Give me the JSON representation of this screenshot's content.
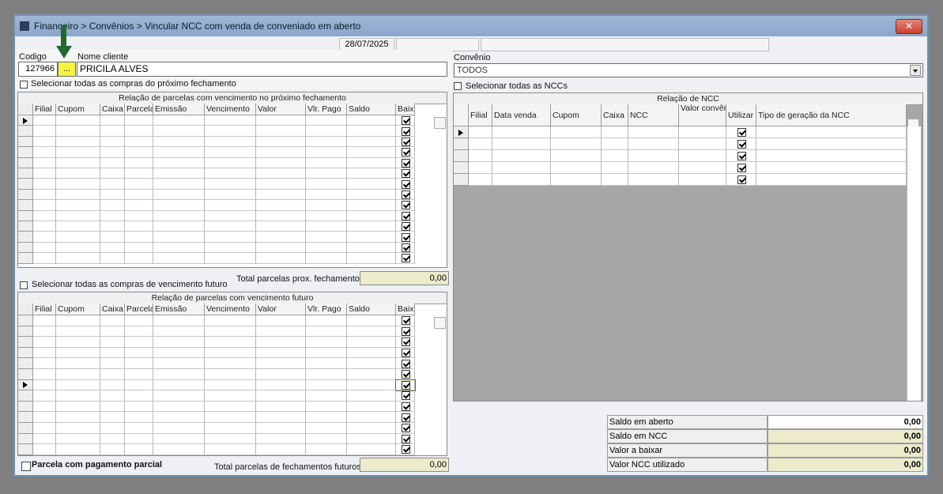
{
  "window": {
    "title": "Financeiro > Convênios > Vincular NCC com venda de conveniado em aberto",
    "close_label": "✕"
  },
  "status": {
    "date": "28/07/2025"
  },
  "client": {
    "codigo_label": "Codigo",
    "codigo_value": "127966",
    "lookup_label": "...",
    "nome_label": "Nome cliente",
    "nome_value": "PRICILA ALVES"
  },
  "convenio": {
    "label": "Convênio",
    "value": "TODOS"
  },
  "select_next": {
    "label": "Selecionar todas as compras do próximo fechamento"
  },
  "select_nccs": {
    "label": "Selecionar todas as NCCs"
  },
  "grid_next": {
    "caption": "Relação de parcelas com vencimento no próximo fechamento",
    "columns": [
      "Filial",
      "Cupom",
      "Caixa",
      "Parcela",
      "Emissão",
      "Vencimento",
      "Valor",
      "Vlr. Pago",
      "Saldo",
      "Baixar"
    ]
  },
  "total_next": {
    "label": "Total parcelas prox. fechamento",
    "value": "0,00"
  },
  "select_future": {
    "label": "Selecionar todas as compras de vencimento futuro"
  },
  "grid_future": {
    "caption": "Relação de parcelas com vencimento futuro",
    "columns": [
      "Filial",
      "Cupom",
      "Caixa",
      "Parcela",
      "Emissão",
      "Vencimento",
      "Valor",
      "Vlr. Pago",
      "Saldo",
      "Baixar"
    ]
  },
  "partial": {
    "label": "Parcela com pagamento parcial"
  },
  "total_future": {
    "label": "Total parcelas de fechamentos futuros",
    "value": "0,00"
  },
  "grid_ncc": {
    "caption": "Relação de NCC",
    "columns": [
      "Filial",
      "Data venda",
      "Cupom",
      "Caixa",
      "NCC",
      "Valor convênio",
      "Utilizar",
      "Tipo de geração da NCC"
    ]
  },
  "summary": {
    "items": [
      {
        "label": "Saldo em aberto",
        "value": "0,00"
      },
      {
        "label": "Saldo em NCC",
        "value": "0,00"
      },
      {
        "label": "Valor a baixar",
        "value": "0,00"
      },
      {
        "label": "Valor NCC utilizado",
        "value": "0,00"
      }
    ]
  },
  "colors": {
    "titlebar": "#8aa6cb",
    "highlight_yellow": "#f5f542",
    "total_bg": "#ecebcc",
    "gray_area": "#a6a6a6",
    "arrow_green": "#1f6b2e"
  }
}
